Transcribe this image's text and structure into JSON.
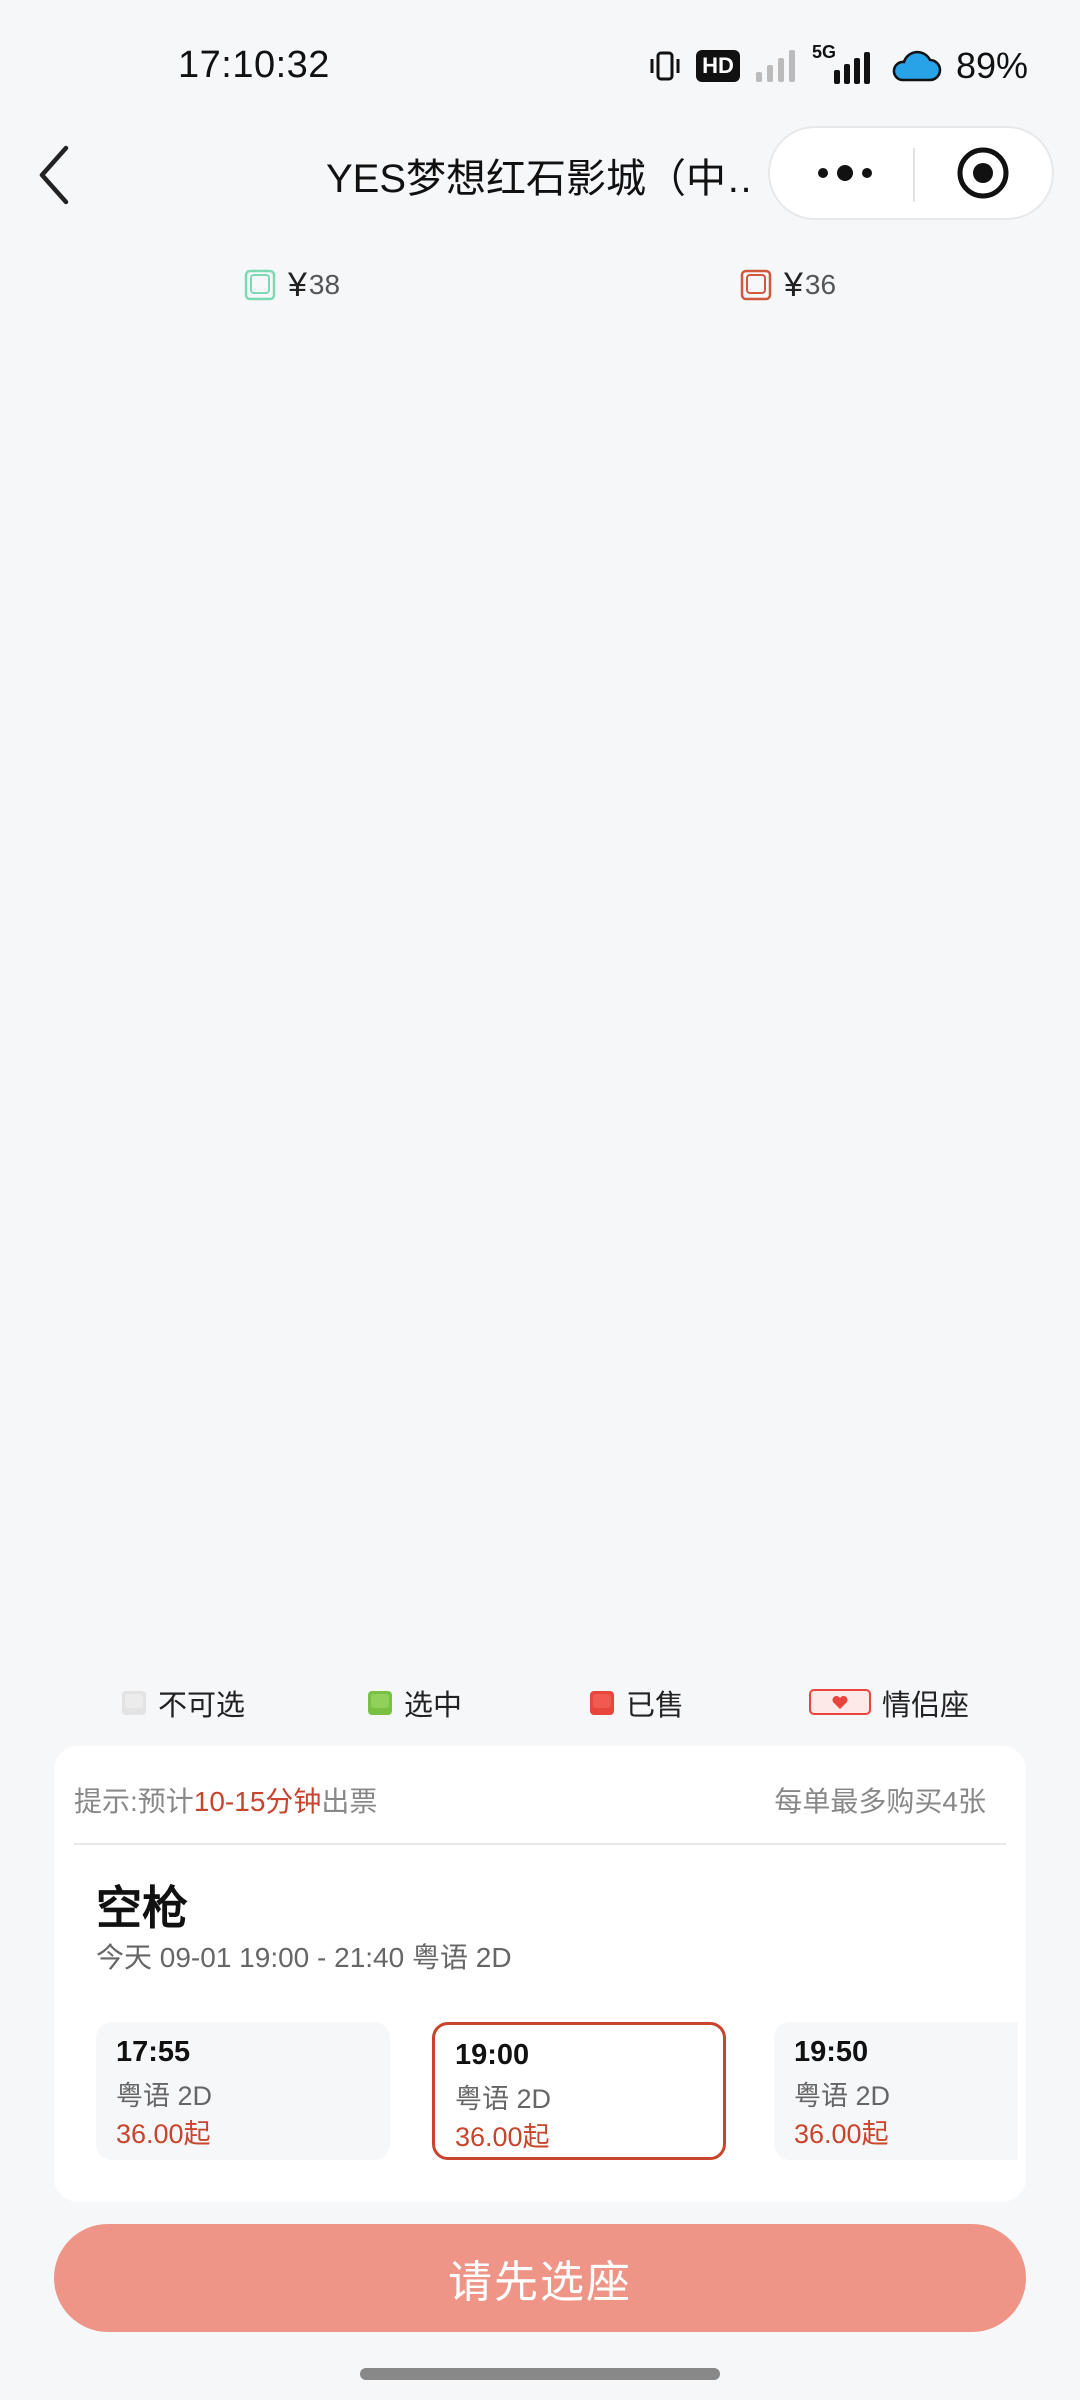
{
  "status_bar": {
    "time": "17:10:32",
    "hd": "HD",
    "network": "5G",
    "battery": "89%",
    "icons": [
      "vibrate-icon",
      "hd-icon",
      "signal-icon",
      "5g-signal-icon",
      "cloud-icon"
    ]
  },
  "nav": {
    "title": "YES梦想红石影城（中…",
    "back_icon": "chevron-left-icon",
    "more_icon": "more-dots-icon",
    "target_icon": "target-icon"
  },
  "price_legend": [
    {
      "symbol": "¥",
      "price": "38",
      "color": "#7dd9b4"
    },
    {
      "symbol": "¥",
      "price": "36",
      "color": "#d0583c"
    }
  ],
  "seat_legend": [
    {
      "label": "不可选",
      "color": "#e3e3e3"
    },
    {
      "label": "选中",
      "color": "#7ac143"
    },
    {
      "label": "已售",
      "color": "#e8453c"
    },
    {
      "label": "情侣座",
      "color": "#e8453c"
    }
  ],
  "card": {
    "tip_prefix": "提示:预计",
    "tip_highlight": "10-15分钟",
    "tip_suffix": "出票",
    "limit": "每单最多购买4张",
    "movie_title": "空枪",
    "movie_info": "今天 09-01 19:00 - 21:40 粤语 2D",
    "sessions": [
      {
        "time": "17:55",
        "lang": "粤语 2D",
        "price": "36.00起",
        "selected": false
      },
      {
        "time": "19:00",
        "lang": "粤语 2D",
        "price": "36.00起",
        "selected": true
      },
      {
        "time": "19:50",
        "lang": "粤语 2D",
        "price": "36.00起",
        "selected": false
      }
    ]
  },
  "confirm_button": "请先选座",
  "accent_color": "#c8442d"
}
